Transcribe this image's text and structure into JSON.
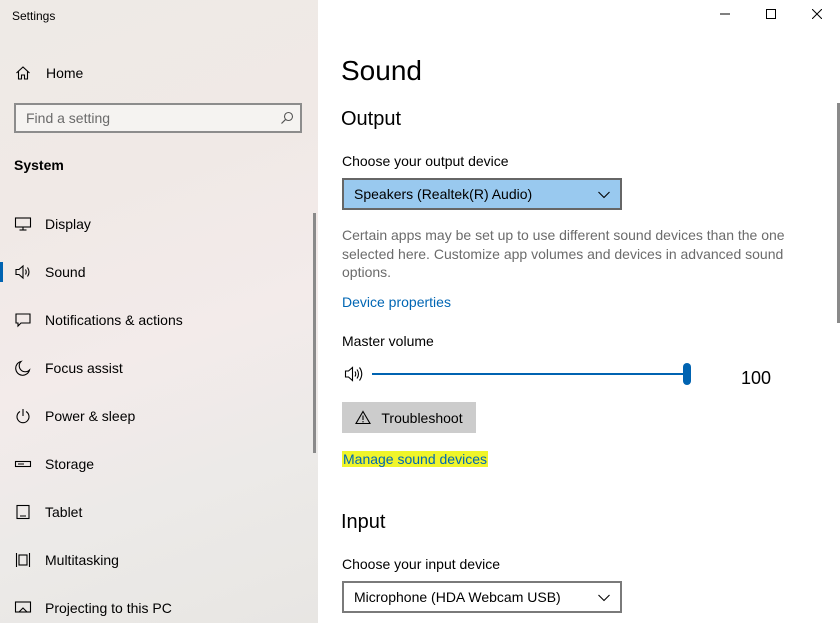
{
  "app": {
    "title": "Settings"
  },
  "sidebar": {
    "home_label": "Home",
    "search_placeholder": "Find a setting",
    "section_title": "System",
    "items": [
      {
        "label": "Display",
        "icon": "display-icon"
      },
      {
        "label": "Sound",
        "icon": "speaker-icon",
        "active": true
      },
      {
        "label": "Notifications & actions",
        "icon": "notifications-icon"
      },
      {
        "label": "Focus assist",
        "icon": "moon-icon"
      },
      {
        "label": "Power & sleep",
        "icon": "power-icon"
      },
      {
        "label": "Storage",
        "icon": "storage-icon"
      },
      {
        "label": "Tablet",
        "icon": "tablet-icon"
      },
      {
        "label": "Multitasking",
        "icon": "multitasking-icon"
      },
      {
        "label": "Projecting to this PC",
        "icon": "projecting-icon"
      }
    ]
  },
  "window_controls": [
    "minimize-icon",
    "maximize-icon",
    "close-icon"
  ],
  "main": {
    "title": "Sound",
    "output": {
      "heading": "Output",
      "device_label": "Choose your output device",
      "device_value": "Speakers (Realtek(R) Audio)",
      "description": "Certain apps may be set up to use different sound devices than the one selected here. Customize app volumes and devices in advanced sound options.",
      "device_properties_link": "Device properties",
      "master_volume_label": "Master volume",
      "master_volume_value": "100",
      "troubleshoot_label": "Troubleshoot",
      "manage_devices_link": "Manage sound devices"
    },
    "input": {
      "heading": "Input",
      "device_label": "Choose your input device",
      "device_value": "Microphone (HDA Webcam USB)"
    }
  },
  "colors": {
    "accent": "#0063b1",
    "link": "#0066b4",
    "highlight": "#f0f52a",
    "select_highlight": "#99c9ef"
  }
}
